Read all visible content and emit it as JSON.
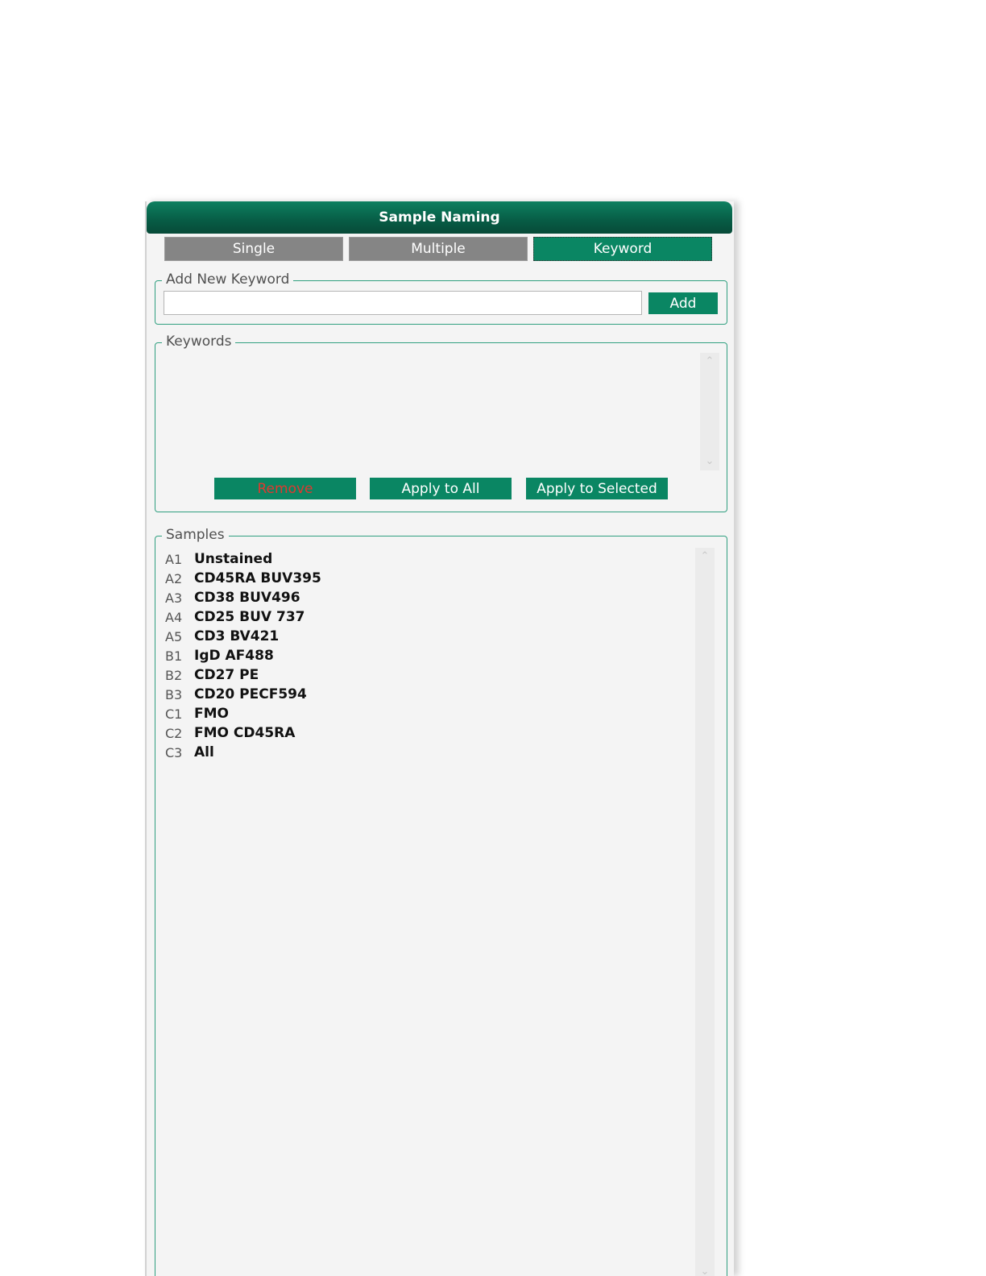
{
  "window": {
    "title": "Sample Naming"
  },
  "tabs": [
    {
      "label": "Single",
      "active": false
    },
    {
      "label": "Multiple",
      "active": false
    },
    {
      "label": "Keyword",
      "active": true
    }
  ],
  "add_keyword": {
    "legend": "Add New Keyword",
    "input_value": "",
    "add_label": "Add"
  },
  "keywords": {
    "legend": "Keywords",
    "items": [],
    "remove_label": "Remove",
    "apply_all_label": "Apply to All",
    "apply_selected_label": "Apply to Selected"
  },
  "samples": {
    "legend": "Samples",
    "items": [
      {
        "well": "A1",
        "name": "Unstained"
      },
      {
        "well": "A2",
        "name": "CD45RA BUV395"
      },
      {
        "well": "A3",
        "name": "CD38 BUV496"
      },
      {
        "well": "A4",
        "name": "CD25 BUV 737"
      },
      {
        "well": "A5",
        "name": "CD3 BV421"
      },
      {
        "well": "B1",
        "name": "IgD AF488"
      },
      {
        "well": "B2",
        "name": "CD27 PE"
      },
      {
        "well": "B3",
        "name": "CD20 PECF594"
      },
      {
        "well": "C1",
        "name": "FMO"
      },
      {
        "well": "C2",
        "name": "FMO CD45RA"
      },
      {
        "well": "C3",
        "name": "All"
      }
    ]
  },
  "colors": {
    "accent": "#0a8663",
    "titlebar": "#075c45",
    "inactive_tab": "#858585",
    "group_border": "#2f9f7f",
    "danger_text": "#e0382f"
  },
  "icons": {
    "scroll_up": "chevron-up-icon",
    "scroll_down": "chevron-down-icon"
  }
}
